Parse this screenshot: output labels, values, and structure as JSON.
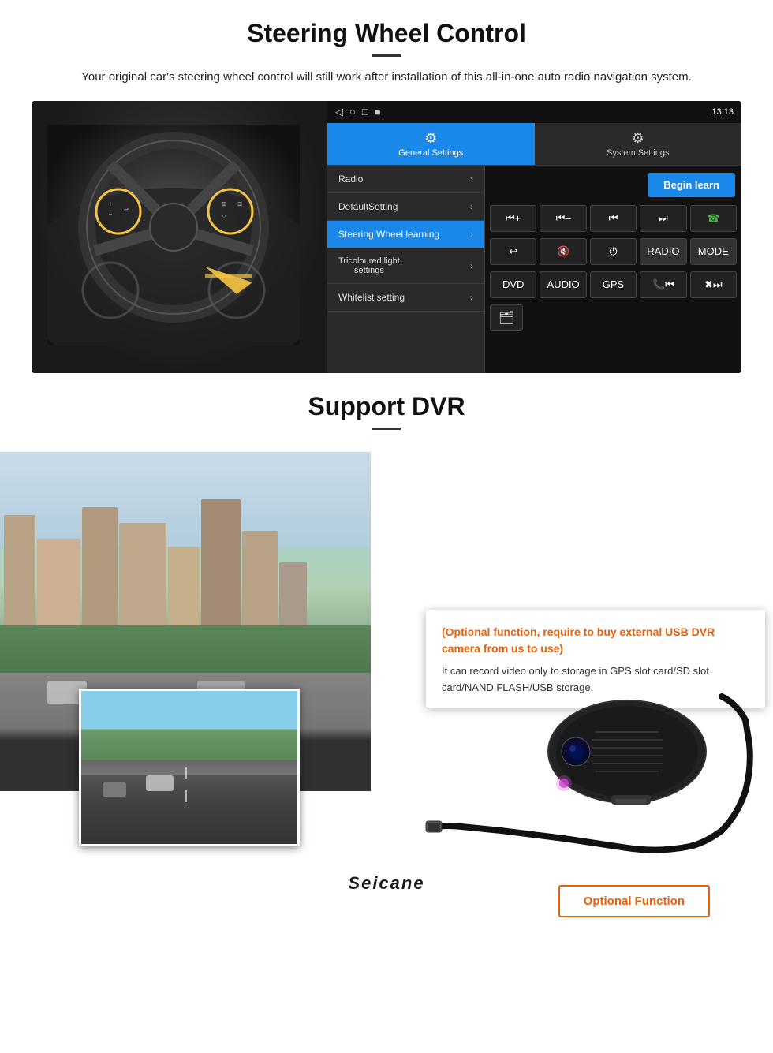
{
  "steering": {
    "title": "Steering Wheel Control",
    "subtitle": "Your original car's steering wheel control will still work after installation of this all-in-one auto radio navigation system.",
    "statusbar": {
      "time": "13:13",
      "icons": [
        "◁",
        "○",
        "□",
        "■"
      ]
    },
    "tabs": {
      "general": {
        "icon": "⚙",
        "label": "General Settings"
      },
      "system": {
        "icon": "🔧",
        "label": "System Settings"
      }
    },
    "menu": [
      {
        "label": "Radio",
        "active": false
      },
      {
        "label": "DefaultSetting",
        "active": false
      },
      {
        "label": "Steering Wheel learning",
        "active": true
      },
      {
        "label": "Tricoloured light settings",
        "active": false
      },
      {
        "label": "Whitelist setting",
        "active": false
      }
    ],
    "begin_learn": "Begin learn",
    "buttons_row1": [
      "⏮+",
      "⏮-",
      "⏮⏮",
      "⏭⏭",
      "📞"
    ],
    "buttons_row2": [
      "↩",
      "🔇",
      "⏻",
      "RADIO",
      "MODE"
    ],
    "buttons_row3": [
      "DVD",
      "AUDIO",
      "GPS",
      "📞⏮",
      "✖⏭"
    ]
  },
  "dvr": {
    "title": "Support DVR",
    "optional_text": "(Optional function, require to buy external USB DVR camera from us to use)",
    "description": "It can record video only to storage in GPS slot card/SD slot card/NAND FLASH/USB storage.",
    "badge_label": "Optional Function",
    "seicane_logo": "Seicane"
  }
}
